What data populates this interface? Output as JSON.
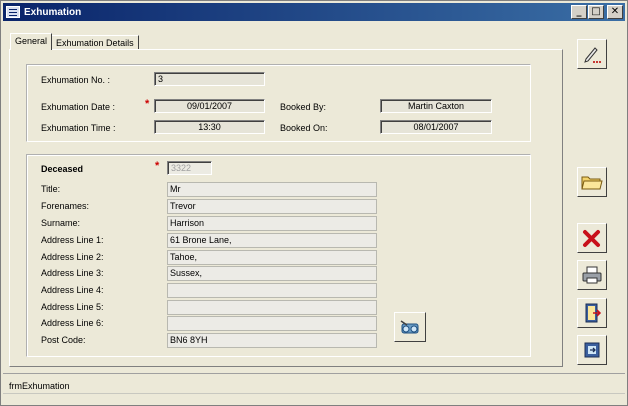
{
  "window": {
    "title": "Exhumation",
    "buttons": {
      "minimize": "_",
      "maximize": "□",
      "close": "✕"
    }
  },
  "tabs": [
    {
      "label": "General",
      "active": true
    },
    {
      "label": "Exhumation Details",
      "active": false
    }
  ],
  "exhumation": {
    "no_label": "Exhumation No. :",
    "no_value": "3",
    "date_label": "Exhumation Date :",
    "date_value": "09/01/2007",
    "time_label": "Exhumation Time :",
    "time_value": "13:30",
    "booked_by_label": "Booked By:",
    "booked_by_value": "Martin Caxton",
    "booked_on_label": "Booked On:",
    "booked_on_value": "08/01/2007",
    "required_mark": "*"
  },
  "deceased": {
    "label": "Deceased",
    "id_value": "3322",
    "required_mark": "*",
    "fields": [
      {
        "label": "Title:",
        "value": "Mr"
      },
      {
        "label": "Forenames:",
        "value": "Trevor"
      },
      {
        "label": "Surname:",
        "value": "Harrison"
      },
      {
        "label": "Address Line 1:",
        "value": "61 Brone Lane,"
      },
      {
        "label": "Address Line 2:",
        "value": "Tahoe,"
      },
      {
        "label": "Address Line 3:",
        "value": "Sussex,"
      },
      {
        "label": "Address Line 4:",
        "value": ""
      },
      {
        "label": "Address Line 5:",
        "value": ""
      },
      {
        "label": "Address Line 6:",
        "value": ""
      },
      {
        "label": "Post Code:",
        "value": "BN6 8YH"
      }
    ]
  },
  "toolbar": {
    "icons": [
      "edit-icon",
      "open-folder-icon",
      "delete-icon",
      "print-icon",
      "exit-door-icon",
      "close-form-icon"
    ]
  },
  "status": {
    "text": "frmExhumation"
  },
  "colors": {
    "titlebar_start": "#0a246a",
    "titlebar_end": "#3a6ea5",
    "required": "#cc0000"
  }
}
